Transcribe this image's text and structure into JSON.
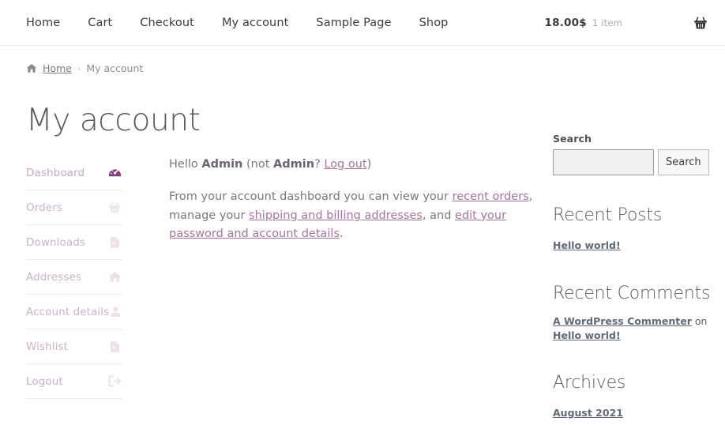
{
  "header": {
    "nav": [
      {
        "label": "Home",
        "name": "nav-item-home"
      },
      {
        "label": "Cart",
        "name": "nav-item-cart"
      },
      {
        "label": "Checkout",
        "name": "nav-item-checkout"
      },
      {
        "label": "My account",
        "name": "nav-item-my-account"
      },
      {
        "label": "Sample Page",
        "name": "nav-item-sample-page"
      },
      {
        "label": "Shop",
        "name": "nav-item-shop"
      }
    ],
    "cart": {
      "total": "18.00$",
      "count": "1 item",
      "icon": "shopping-basket-icon"
    }
  },
  "breadcrumb": {
    "home_icon": "home-icon",
    "home": "Home",
    "separator": "›",
    "current": "My account"
  },
  "main": {
    "title": "My account",
    "account_nav": [
      {
        "label": "Dashboard",
        "icon": "dashboard-gauge-icon",
        "active": true
      },
      {
        "label": "Orders",
        "icon": "basket-icon",
        "active": false
      },
      {
        "label": "Downloads",
        "icon": "download-file-icon",
        "active": false
      },
      {
        "label": "Addresses",
        "icon": "house-icon",
        "active": false
      },
      {
        "label": "Account details",
        "icon": "user-icon",
        "active": false
      },
      {
        "label": "Wishlist",
        "icon": "document-icon",
        "active": false
      },
      {
        "label": "Logout",
        "icon": "logout-arrow-icon",
        "active": false
      }
    ],
    "greeting": {
      "hello_prefix": "Hello ",
      "user_name": "Admin",
      "not_prefix": " (not ",
      "not_user_name": "Admin",
      "question": "? ",
      "logout_link": "Log out",
      "closing": ")"
    },
    "description": {
      "part1": "From your account dashboard you can view your ",
      "link1": "recent orders",
      "part2": ", manage your ",
      "link2": "shipping and billing addresses",
      "part3": ", and ",
      "link3": "edit your password and account details",
      "part4": "."
    }
  },
  "sidebar": {
    "search": {
      "label": "Search",
      "value": "",
      "placeholder": "",
      "button_label": "Search"
    },
    "recent_posts": {
      "title": "Recent Posts",
      "items": [
        {
          "label": "Hello world!"
        }
      ]
    },
    "recent_comments": {
      "title": "Recent Comments",
      "items": [
        {
          "author": "A WordPress Commenter",
          "on": " on ",
          "post": "Hello world!"
        }
      ]
    },
    "archives": {
      "title": "Archives",
      "items": [
        {
          "label": "August 2021"
        }
      ]
    }
  },
  "colors": {
    "accent_purple": "#7e3f7a",
    "muted_purple": "#cdb2c7",
    "link_mauve": "#a5759f",
    "text_grey": "#7d757f",
    "border_light": "#efe9ef"
  }
}
